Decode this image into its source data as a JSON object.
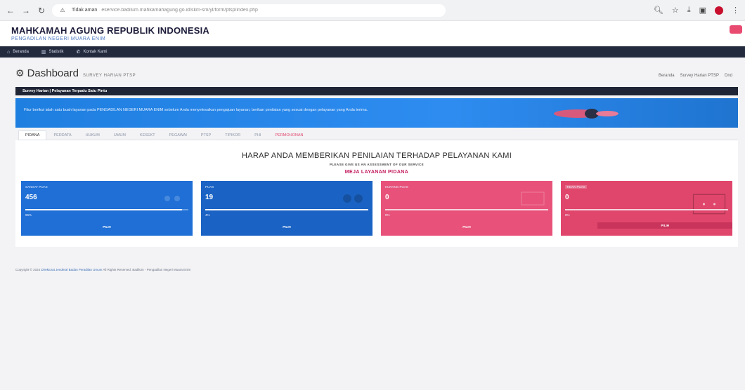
{
  "browser": {
    "security_label": "Tidak aman",
    "url": "eservice.badilum.mahkamahagung.go.id/skm-sm/yl/form/ptsp/index.php"
  },
  "header": {
    "title": "MAHKAMAH AGUNG REPUBLIK INDONESIA",
    "subtitle": "PENGADILAN NEGERI MUARA ENIM"
  },
  "navbar": {
    "items": [
      {
        "label": "Beranda",
        "icon": "home-icon"
      },
      {
        "label": "Statistik",
        "icon": "chart-icon"
      },
      {
        "label": "Kontak Kami",
        "icon": "phone-icon"
      }
    ]
  },
  "dashboard": {
    "title": "Dashboard",
    "subtitle": "SURVEY HARIAN PTSP",
    "breadcrumb": [
      "Beranda",
      "Survey Harian PTSP",
      "Dnd"
    ]
  },
  "strip": {
    "title": "Survey Harian | Pelayanan Terpadu Satu Pintu"
  },
  "banner": {
    "text": "Fitur berikut ialah satu buah layanan pada PENGADILAN NEGERI MUARA ENIM sebelum Anda menyelesaikan pengajuan layanan, berikan penilaian yang sesuai dengan pelayanan yang Anda terima."
  },
  "tabs": {
    "items": [
      "PIDANA",
      "PERDATA",
      "HUKUM",
      "UMUM",
      "KESEKT",
      "PEGAWAI",
      "PTSP",
      "TIPIKOR",
      "PHI",
      "PERMOHONAN"
    ],
    "active_index": 0
  },
  "content": {
    "heading": "HARAP ANDA MEMBERIKAN PENILAIAN TERHADAP PELAYANAN KAMI",
    "subheading": "PLEASE GIVE US AN ASSESSMENT OF OUR SERVICE",
    "desk": "MEJA LAYANAN PIDANA"
  },
  "cards": [
    {
      "label": "SANGAT PUAS",
      "value": "456",
      "percent_label": "96%",
      "progress": 0.96,
      "action": "PILIH",
      "color": "#1f6fd6"
    },
    {
      "label": "PUAS",
      "value": "19",
      "percent_label": "4%",
      "progress": 0.04,
      "action": "PILIH",
      "color": "#1a63c4"
    },
    {
      "label": "KURANG PUAS",
      "value": "0",
      "percent_label": "0%",
      "progress": 0.0,
      "action": "PILIH",
      "color": "#e8527a"
    },
    {
      "label": "TIDAK PUAS",
      "value": "0",
      "percent_label": "0%",
      "progress": 0.0,
      "action": "PILIH",
      "color": "#e0466c"
    }
  ],
  "footer": {
    "copyright": "Copyright © 2024",
    "owner": "Direktorat Jenderal Badan Peradilan Umum",
    "rest": " All Rights Reserved. Badilum - Pengadilan Negeri Muara Enim"
  },
  "colors": {
    "navbar": "#232a3d",
    "banner": "#1f7fe0",
    "accent_pink": "#c2185b"
  }
}
